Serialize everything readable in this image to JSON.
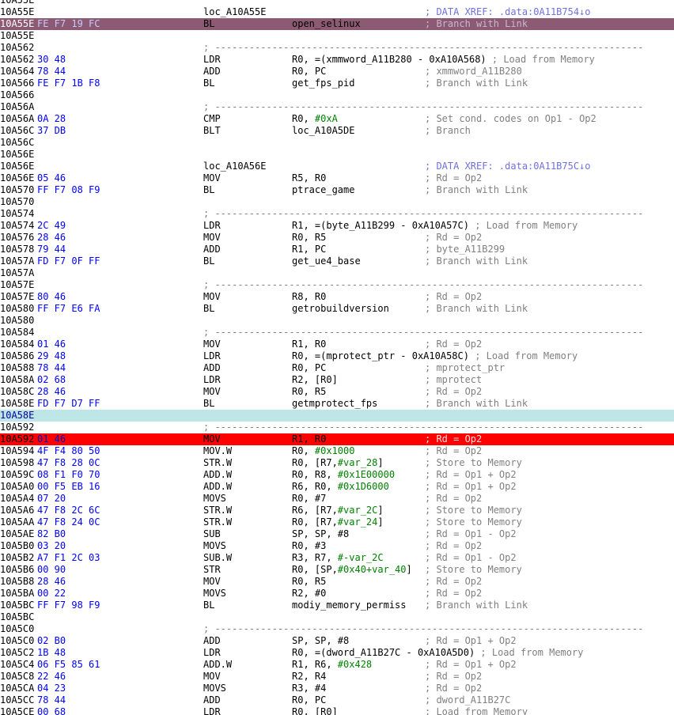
{
  "listing": {
    "separator": "; ---------------------------------------------------------------------------",
    "rows": [
      {
        "addr": "10A55E",
        "state": "",
        "bytes": "",
        "label": "",
        "mnem": "",
        "ops": [],
        "cmt": "",
        "xref": ""
      },
      {
        "addr": "10A55E",
        "state": "",
        "bytes": "",
        "label": "loc_A10A55E",
        "mnem": "",
        "ops": [],
        "cmt": "",
        "xref": "; DATA XREF: .data:0A11B754↓o"
      },
      {
        "addr": "10A55E",
        "state": "exec",
        "bytes": "FE F7 19 FC",
        "label": "",
        "mnem": "BL",
        "ops": [
          {
            "t": "open_selinux"
          }
        ],
        "cmt": "; Branch with Link"
      },
      {
        "addr": "10A55E",
        "state": "",
        "bytes": "",
        "label": "",
        "mnem": "",
        "ops": [],
        "cmt": ""
      },
      {
        "addr": "10A562",
        "state": "",
        "bytes": "",
        "label": "",
        "mnem": "",
        "ops": [],
        "cmt": "",
        "sep": true
      },
      {
        "addr": "10A562",
        "state": "",
        "bytes": "30 48",
        "mnem": "LDR",
        "ops": [
          {
            "t": "R0, =(xmmword_A11B280 - 0xA10A568)"
          }
        ],
        "cmt": "; Load from Memory",
        "cmt_inline": true
      },
      {
        "addr": "10A564",
        "state": "",
        "bytes": "78 44",
        "mnem": "ADD",
        "ops": [
          {
            "t": "R0, PC"
          }
        ],
        "cmt": "; xmmword_A11B280"
      },
      {
        "addr": "10A566",
        "state": "",
        "bytes": "FE F7 1B F8",
        "mnem": "BL",
        "ops": [
          {
            "t": "get_fps_pid"
          }
        ],
        "cmt": "; Branch with Link"
      },
      {
        "addr": "10A566",
        "state": "",
        "bytes": "",
        "mnem": "",
        "ops": [],
        "cmt": ""
      },
      {
        "addr": "10A56A",
        "state": "",
        "bytes": "",
        "mnem": "",
        "ops": [],
        "cmt": "",
        "sep": true
      },
      {
        "addr": "10A56A",
        "state": "",
        "bytes": "0A 28",
        "mnem": "CMP",
        "ops": [
          {
            "t": "R0, "
          },
          {
            "t": "#0xA",
            "num": true
          }
        ],
        "cmt": "; Set cond. codes on Op1 - Op2"
      },
      {
        "addr": "10A56C",
        "state": "",
        "bytes": "37 DB",
        "mnem": "BLT",
        "ops": [
          {
            "t": "loc_A10A5DE"
          }
        ],
        "cmt": "; Branch"
      },
      {
        "addr": "10A56C",
        "state": "",
        "bytes": "",
        "mnem": "",
        "ops": [],
        "cmt": ""
      },
      {
        "addr": "10A56E",
        "state": "",
        "bytes": "",
        "mnem": "",
        "ops": [],
        "cmt": ""
      },
      {
        "addr": "10A56E",
        "state": "",
        "bytes": "",
        "label": "loc_A10A56E",
        "mnem": "",
        "ops": [],
        "cmt": "",
        "xref": "; DATA XREF: .data:0A11B75C↓o"
      },
      {
        "addr": "10A56E",
        "state": "",
        "bytes": "05 46",
        "mnem": "MOV",
        "ops": [
          {
            "t": "R5, R0"
          }
        ],
        "cmt": "; Rd = Op2"
      },
      {
        "addr": "10A570",
        "state": "",
        "bytes": "FF F7 08 F9",
        "mnem": "BL",
        "ops": [
          {
            "t": "ptrace_game"
          }
        ],
        "cmt": "; Branch with Link"
      },
      {
        "addr": "10A570",
        "state": "",
        "bytes": "",
        "mnem": "",
        "ops": [],
        "cmt": ""
      },
      {
        "addr": "10A574",
        "state": "",
        "bytes": "",
        "mnem": "",
        "ops": [],
        "cmt": "",
        "sep": true
      },
      {
        "addr": "10A574",
        "state": "",
        "bytes": "2C 49",
        "mnem": "LDR",
        "ops": [
          {
            "t": "R1, =(byte_A11B299 - 0xA10A57C)"
          }
        ],
        "cmt": "; Load from Memory",
        "cmt_inline": true
      },
      {
        "addr": "10A576",
        "state": "",
        "bytes": "28 46",
        "mnem": "MOV",
        "ops": [
          {
            "t": "R0, R5"
          }
        ],
        "cmt": "; Rd = Op2"
      },
      {
        "addr": "10A578",
        "state": "",
        "bytes": "79 44",
        "mnem": "ADD",
        "ops": [
          {
            "t": "R1, PC"
          }
        ],
        "cmt": "; byte_A11B299"
      },
      {
        "addr": "10A57A",
        "state": "",
        "bytes": "FD F7 0F FF",
        "mnem": "BL",
        "ops": [
          {
            "t": "get_ue4_base"
          }
        ],
        "cmt": "; Branch with Link"
      },
      {
        "addr": "10A57A",
        "state": "",
        "bytes": "",
        "mnem": "",
        "ops": [],
        "cmt": ""
      },
      {
        "addr": "10A57E",
        "state": "",
        "bytes": "",
        "mnem": "",
        "ops": [],
        "cmt": "",
        "sep": true
      },
      {
        "addr": "10A57E",
        "state": "",
        "bytes": "80 46",
        "mnem": "MOV",
        "ops": [
          {
            "t": "R8, R0"
          }
        ],
        "cmt": "; Rd = Op2"
      },
      {
        "addr": "10A580",
        "state": "",
        "bytes": "FF F7 E6 FA",
        "mnem": "BL",
        "ops": [
          {
            "t": "getrobuildversion"
          }
        ],
        "cmt": "; Branch with Link"
      },
      {
        "addr": "10A580",
        "state": "",
        "bytes": "",
        "mnem": "",
        "ops": [],
        "cmt": ""
      },
      {
        "addr": "10A584",
        "state": "",
        "bytes": "",
        "mnem": "",
        "ops": [],
        "cmt": "",
        "sep": true
      },
      {
        "addr": "10A584",
        "state": "",
        "bytes": "01 46",
        "mnem": "MOV",
        "ops": [
          {
            "t": "R1, R0"
          }
        ],
        "cmt": "; Rd = Op2"
      },
      {
        "addr": "10A586",
        "state": "",
        "bytes": "29 48",
        "mnem": "LDR",
        "ops": [
          {
            "t": "R0, =(mprotect_ptr - 0xA10A58C)"
          }
        ],
        "cmt": "; Load from Memory",
        "cmt_inline": true
      },
      {
        "addr": "10A588",
        "state": "",
        "bytes": "78 44",
        "mnem": "ADD",
        "ops": [
          {
            "t": "R0, PC"
          }
        ],
        "cmt": "; mprotect_ptr"
      },
      {
        "addr": "10A58A",
        "state": "",
        "bytes": "02 68",
        "mnem": "LDR",
        "ops": [
          {
            "t": "R2, [R0]"
          }
        ],
        "cmt": "; mprotect"
      },
      {
        "addr": "10A58C",
        "state": "",
        "bytes": "28 46",
        "mnem": "MOV",
        "ops": [
          {
            "t": "R0, R5"
          }
        ],
        "cmt": "; Rd = Op2"
      },
      {
        "addr": "10A58E",
        "state": "",
        "bytes": "FD F7 D7 FF",
        "mnem": "BL",
        "ops": [
          {
            "t": "getmprotect_fps"
          }
        ],
        "cmt": "; Branch with Link"
      },
      {
        "addr": "10A58E",
        "state": "cur",
        "bytes": "",
        "mnem": "",
        "ops": [],
        "cmt": ""
      },
      {
        "addr": "10A592",
        "state": "",
        "bytes": "",
        "mnem": "",
        "ops": [],
        "cmt": "",
        "sep": true
      },
      {
        "addr": "10A592",
        "state": "bp",
        "bytes": "01 46",
        "mnem": "MOV",
        "ops": [
          {
            "t": "R1, R0"
          }
        ],
        "cmt": "; Rd = Op2"
      },
      {
        "addr": "10A594",
        "state": "",
        "bytes": "4F F4 80 50",
        "mnem": "MOV.W",
        "ops": [
          {
            "t": "R0, "
          },
          {
            "t": "#0x1000",
            "num": true
          }
        ],
        "cmt": "; Rd = Op2"
      },
      {
        "addr": "10A598",
        "state": "",
        "bytes": "47 F8 28 0C",
        "mnem": "STR.W",
        "ops": [
          {
            "t": "R0, [R7,"
          },
          {
            "t": "#var_28",
            "num": true
          },
          {
            "t": "]"
          }
        ],
        "cmt": "; Store to Memory"
      },
      {
        "addr": "10A59C",
        "state": "",
        "bytes": "08 F1 F0 70",
        "mnem": "ADD.W",
        "ops": [
          {
            "t": "R0, R8, "
          },
          {
            "t": "#0x1E00000",
            "num": true
          }
        ],
        "cmt": "; Rd = Op1 + Op2"
      },
      {
        "addr": "10A5A0",
        "state": "",
        "bytes": "00 F5 EB 16",
        "mnem": "ADD.W",
        "ops": [
          {
            "t": "R6, R0, "
          },
          {
            "t": "#0x1D6000",
            "num": true
          }
        ],
        "cmt": "; Rd = Op1 + Op2"
      },
      {
        "addr": "10A5A4",
        "state": "",
        "bytes": "07 20",
        "mnem": "MOVS",
        "ops": [
          {
            "t": "R0, #7"
          }
        ],
        "cmt": "; Rd = Op2"
      },
      {
        "addr": "10A5A6",
        "state": "",
        "bytes": "47 F8 2C 6C",
        "mnem": "STR.W",
        "ops": [
          {
            "t": "R6, [R7,"
          },
          {
            "t": "#var_2C",
            "num": true
          },
          {
            "t": "]"
          }
        ],
        "cmt": "; Store to Memory"
      },
      {
        "addr": "10A5AA",
        "state": "",
        "bytes": "47 F8 24 0C",
        "mnem": "STR.W",
        "ops": [
          {
            "t": "R0, [R7,"
          },
          {
            "t": "#var_24",
            "num": true
          },
          {
            "t": "]"
          }
        ],
        "cmt": "; Store to Memory"
      },
      {
        "addr": "10A5AE",
        "state": "",
        "bytes": "82 B0",
        "mnem": "SUB",
        "ops": [
          {
            "t": "SP, SP, #8"
          }
        ],
        "cmt": "; Rd = Op1 - Op2"
      },
      {
        "addr": "10A5B0",
        "state": "",
        "bytes": "03 20",
        "mnem": "MOVS",
        "ops": [
          {
            "t": "R0, #3"
          }
        ],
        "cmt": "; Rd = Op2"
      },
      {
        "addr": "10A5B2",
        "state": "",
        "bytes": "A7 F1 2C 03",
        "mnem": "SUB.W",
        "ops": [
          {
            "t": "R3, R7, "
          },
          {
            "t": "#-var_2C",
            "num": true
          }
        ],
        "cmt": "; Rd = Op1 - Op2"
      },
      {
        "addr": "10A5B6",
        "state": "",
        "bytes": "00 90",
        "mnem": "STR",
        "ops": [
          {
            "t": "R0, [SP,"
          },
          {
            "t": "#0x40+var_40",
            "num": true
          },
          {
            "t": "]"
          }
        ],
        "cmt": "; Store to Memory"
      },
      {
        "addr": "10A5B8",
        "state": "",
        "bytes": "28 46",
        "mnem": "MOV",
        "ops": [
          {
            "t": "R0, R5"
          }
        ],
        "cmt": "; Rd = Op2"
      },
      {
        "addr": "10A5BA",
        "state": "",
        "bytes": "00 22",
        "mnem": "MOVS",
        "ops": [
          {
            "t": "R2, #0"
          }
        ],
        "cmt": "; Rd = Op2"
      },
      {
        "addr": "10A5BC",
        "state": "",
        "bytes": "FF F7 98 F9",
        "mnem": "BL",
        "ops": [
          {
            "t": "modiy_memory_permiss"
          }
        ],
        "cmt": "; Branch with Link"
      },
      {
        "addr": "10A5BC",
        "state": "",
        "bytes": "",
        "mnem": "",
        "ops": [],
        "cmt": ""
      },
      {
        "addr": "10A5C0",
        "state": "",
        "bytes": "",
        "mnem": "",
        "ops": [],
        "cmt": "",
        "sep": true
      },
      {
        "addr": "10A5C0",
        "state": "",
        "bytes": "02 B0",
        "mnem": "ADD",
        "ops": [
          {
            "t": "SP, SP, #8"
          }
        ],
        "cmt": "; Rd = Op1 + Op2"
      },
      {
        "addr": "10A5C2",
        "state": "",
        "bytes": "1B 48",
        "mnem": "LDR",
        "ops": [
          {
            "t": "R0, =(dword_A11B27C - 0xA10A5D0)"
          }
        ],
        "cmt": "; Load from Memory",
        "cmt_inline": true
      },
      {
        "addr": "10A5C4",
        "state": "",
        "bytes": "06 F5 85 61",
        "mnem": "ADD.W",
        "ops": [
          {
            "t": "R1, R6, "
          },
          {
            "t": "#0x428",
            "num": true
          }
        ],
        "cmt": "; Rd = Op1 + Op2"
      },
      {
        "addr": "10A5C8",
        "state": "",
        "bytes": "22 46",
        "mnem": "MOV",
        "ops": [
          {
            "t": "R2, R4"
          }
        ],
        "cmt": "; Rd = Op2"
      },
      {
        "addr": "10A5CA",
        "state": "",
        "bytes": "04 23",
        "mnem": "MOVS",
        "ops": [
          {
            "t": "R3, #4"
          }
        ],
        "cmt": "; Rd = Op2"
      },
      {
        "addr": "10A5CC",
        "state": "",
        "bytes": "78 44",
        "mnem": "ADD",
        "ops": [
          {
            "t": "R0, PC"
          }
        ],
        "cmt": "; dword_A11B27C"
      },
      {
        "addr": "10A5CE",
        "state": "",
        "bytes": "00 68",
        "mnem": "LDR",
        "ops": [
          {
            "t": "R0, [R0]"
          }
        ],
        "cmt": "; Load from Memory"
      }
    ]
  }
}
